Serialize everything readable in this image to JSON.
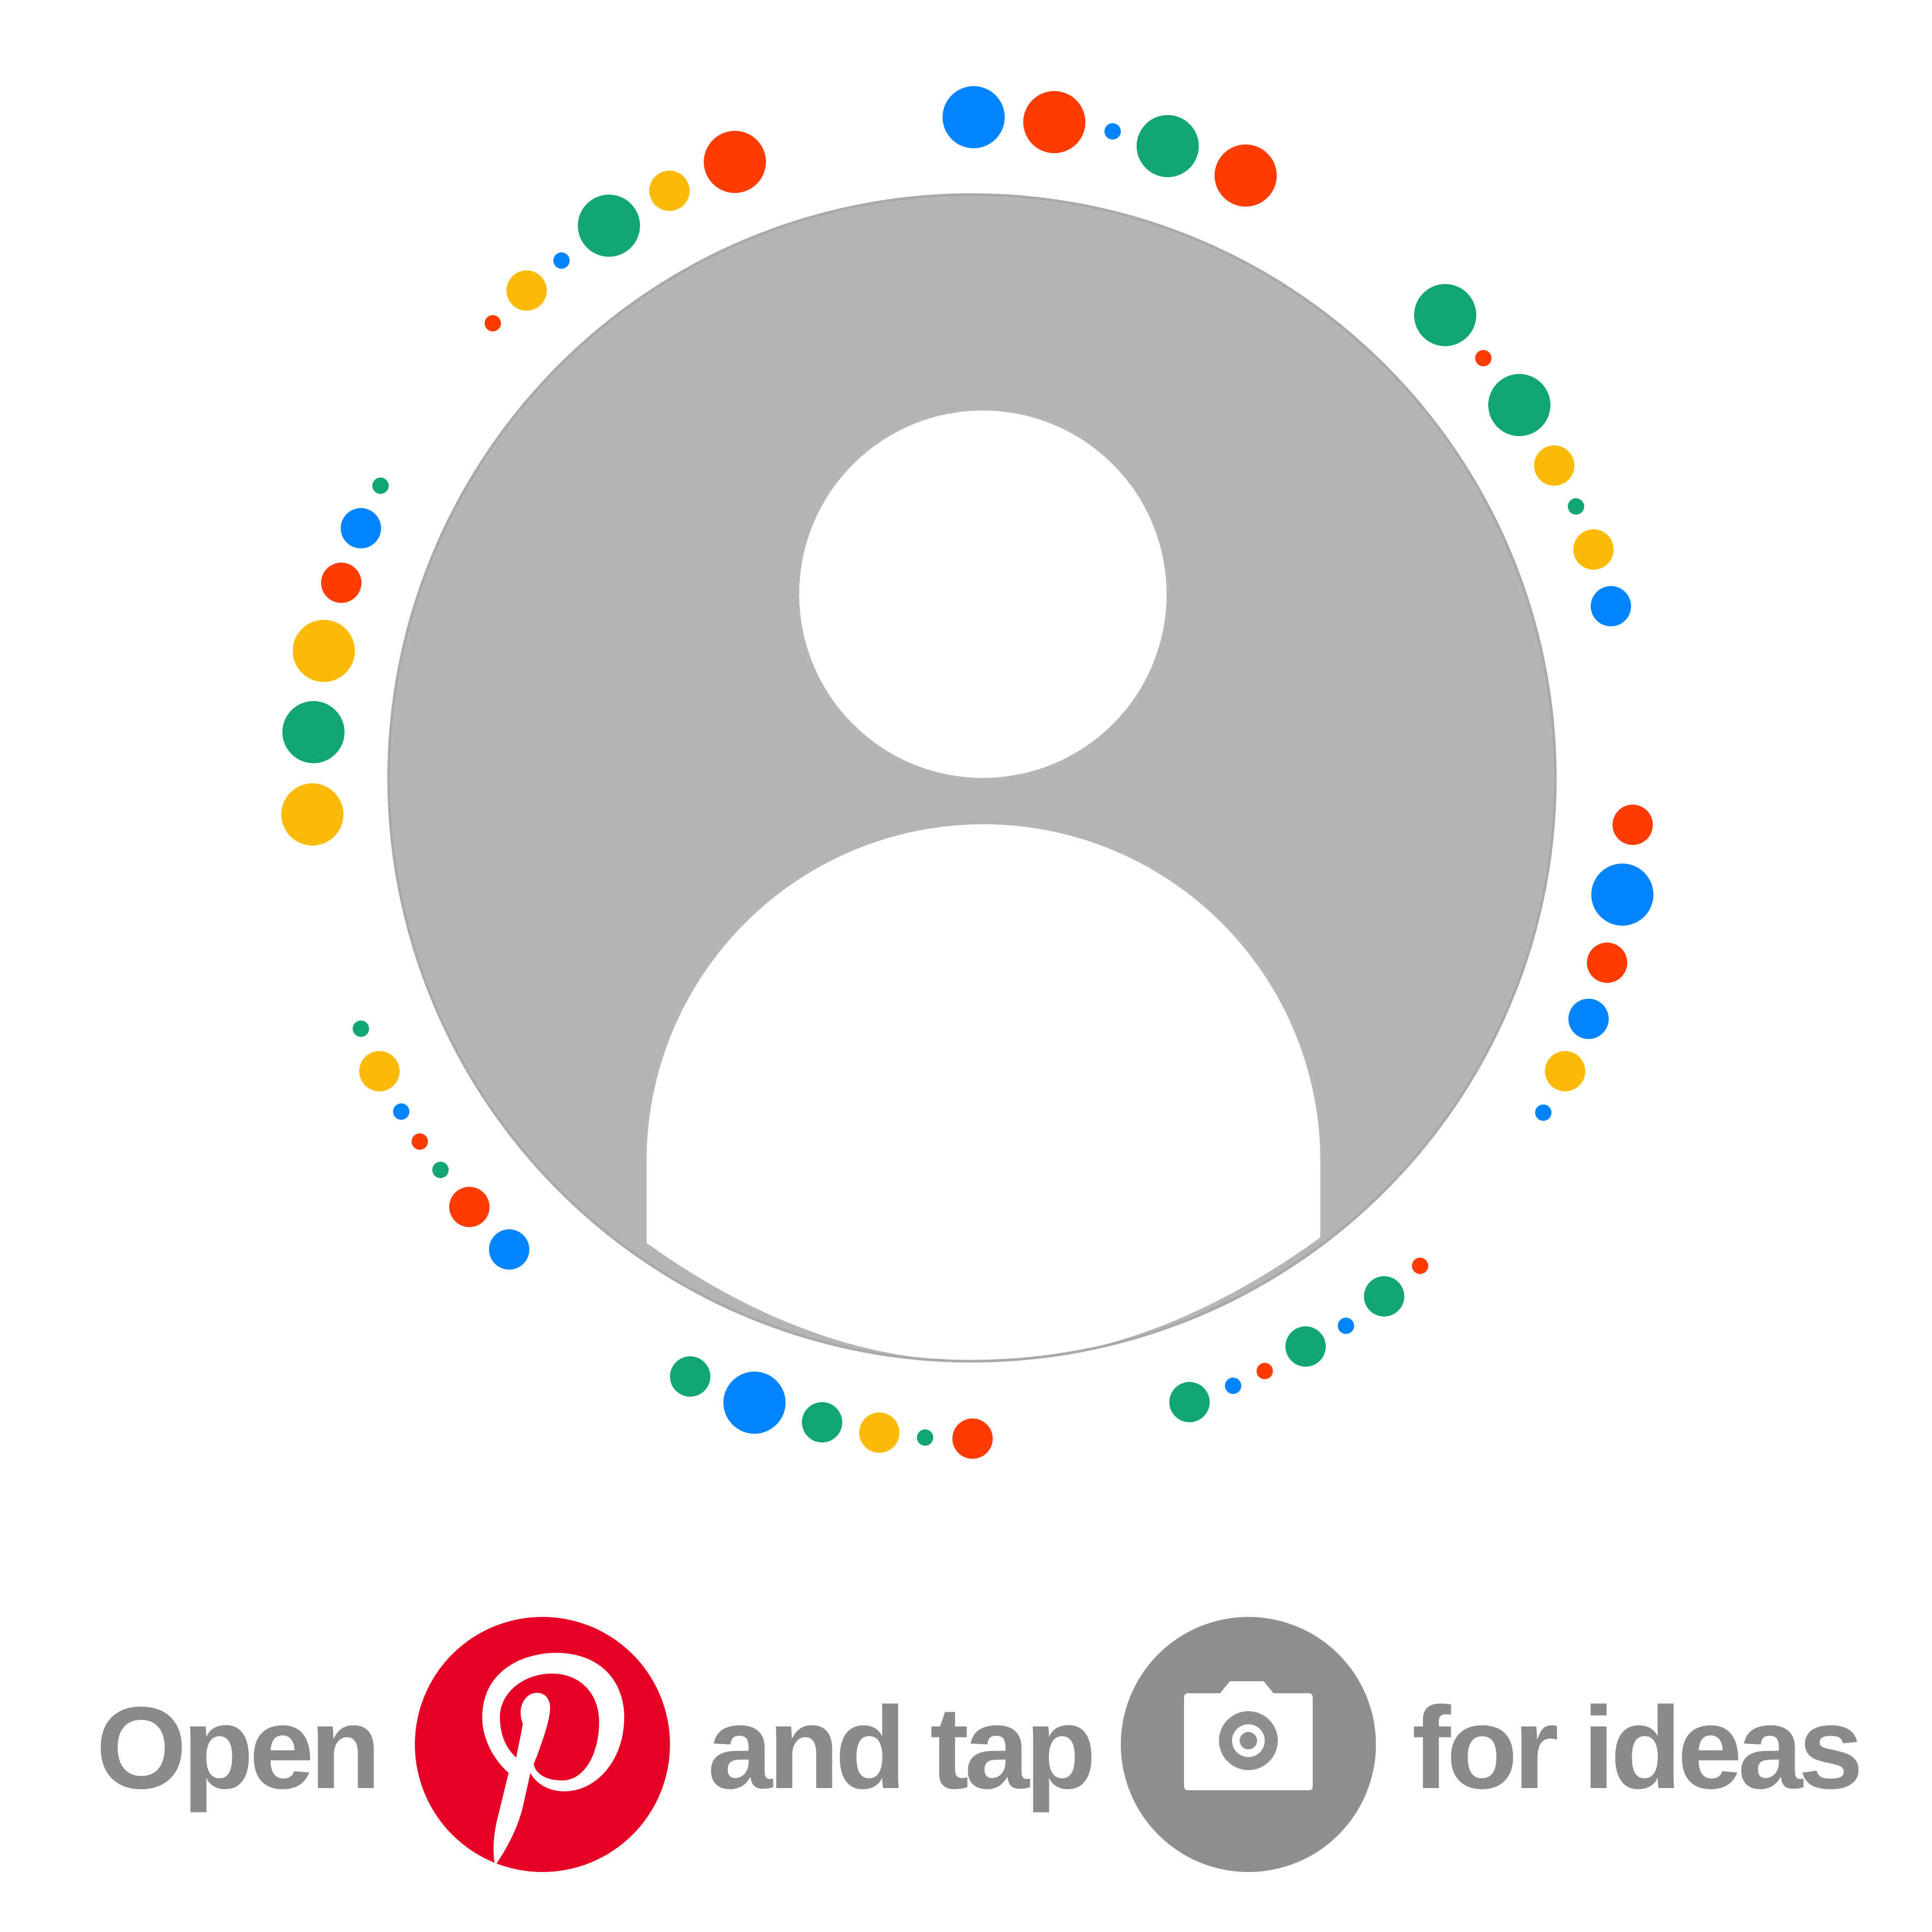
{
  "caption": {
    "open": "Open",
    "and_tap": "and tap",
    "for_ideas": "for ideas"
  },
  "icons": {
    "avatar": "default-profile-avatar-icon",
    "logo": "pinterest-logo-icon",
    "camera": "camera-icon"
  },
  "colors": {
    "background": "#ffffff",
    "avatar_circle": "#b5b5b5",
    "avatar_figure": "#ffffff",
    "pinterest_red": "#e60023",
    "camera_badge": "#8f8f8f",
    "caption_text": "#8a8a8a",
    "dot_blue": "#0084ff",
    "dot_red": "#ff3c00",
    "dot_green": "#10a571",
    "dot_yellow": "#fbba05"
  }
}
